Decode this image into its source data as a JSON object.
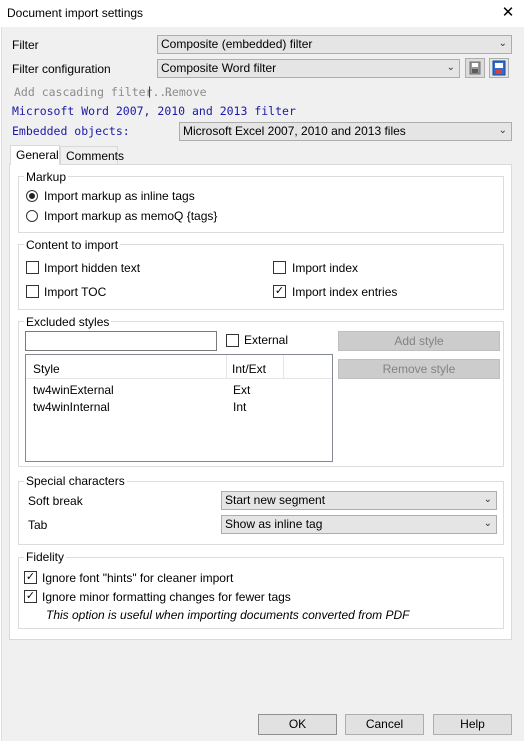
{
  "window": {
    "title": "Document import settings",
    "close_glyph": "✕"
  },
  "filter": {
    "label": "Filter",
    "value": "Composite (embedded) filter"
  },
  "filter_config": {
    "label": "Filter configuration",
    "value": "Composite Word filter"
  },
  "actions": {
    "add_cascading": "Add cascading filter...",
    "separator": "|",
    "remove": "Remove"
  },
  "filter_name": "Microsoft Word 2007, 2010 and 2013 filter",
  "embedded": {
    "label": "Embedded objects:",
    "value": "Microsoft Excel 2007, 2010 and 2013 files"
  },
  "tabs": [
    {
      "label": "General",
      "active": true
    },
    {
      "label": "Comments",
      "active": false
    }
  ],
  "markup": {
    "title": "Markup",
    "options": [
      {
        "label": "Import markup as inline tags",
        "selected": true
      },
      {
        "label": "Import markup as memoQ {tags}",
        "selected": false
      }
    ]
  },
  "content": {
    "title": "Content to import",
    "items": [
      {
        "label": "Import hidden text",
        "checked": false
      },
      {
        "label": "Import index",
        "checked": false
      },
      {
        "label": "Import TOC",
        "checked": false
      },
      {
        "label": "Import index entries",
        "checked": true
      }
    ]
  },
  "excluded": {
    "title": "Excluded styles",
    "input_value": "",
    "external_label": "External",
    "external_checked": false,
    "add_button": "Add style",
    "remove_button": "Remove style",
    "columns": [
      "Style",
      "Int/Ext"
    ],
    "rows": [
      {
        "style": "tw4winExternal",
        "type": "Ext"
      },
      {
        "style": "tw4winInternal",
        "type": "Int"
      }
    ]
  },
  "special": {
    "title": "Special characters",
    "soft_break_label": "Soft break",
    "soft_break_value": "Start new segment",
    "tab_label": "Tab",
    "tab_value": "Show as inline tag"
  },
  "fidelity": {
    "title": "Fidelity",
    "ignore_hints": {
      "label": "Ignore font \"hints\" for cleaner import",
      "checked": true
    },
    "ignore_minor": {
      "label": "Ignore minor formatting changes for fewer tags",
      "checked": true
    },
    "note": "This option is useful when importing documents converted from PDF"
  },
  "footer": {
    "ok": "OK",
    "cancel": "Cancel",
    "help": "Help"
  }
}
